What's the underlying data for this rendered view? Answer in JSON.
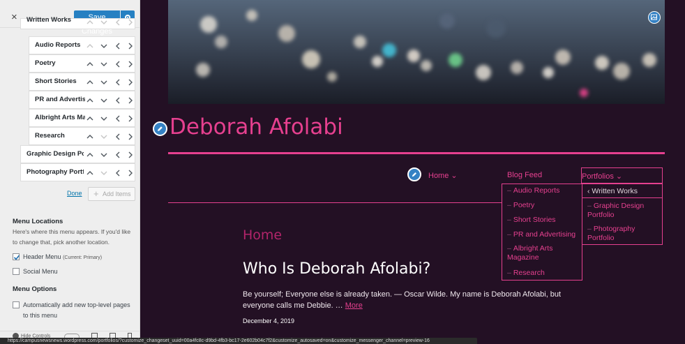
{
  "toolbar": {
    "close_label": "×",
    "save_label": "Save Changes"
  },
  "menu_items": [
    {
      "label": "Written Works",
      "level": 0,
      "arrows": [
        "up",
        "down",
        "left",
        "right"
      ],
      "dim": [
        true,
        true,
        true,
        true
      ]
    },
    {
      "label": "Audio Reports",
      "level": 1,
      "arrows": [
        "up",
        "down",
        "left",
        "right"
      ],
      "dim": [
        true,
        false,
        false,
        false
      ]
    },
    {
      "label": "Poetry",
      "level": 1,
      "arrows": [
        "up",
        "down",
        "left",
        "right"
      ],
      "dim": [
        false,
        false,
        false,
        false
      ]
    },
    {
      "label": "Short Stories",
      "level": 1,
      "arrows": [
        "up",
        "down",
        "left",
        "right"
      ],
      "dim": [
        false,
        false,
        false,
        false
      ]
    },
    {
      "label": "PR and Advertising",
      "level": 1,
      "arrows": [
        "up",
        "down",
        "left",
        "right"
      ],
      "dim": [
        false,
        false,
        false,
        false
      ]
    },
    {
      "label": "Albright Arts Magazine",
      "level": 1,
      "arrows": [
        "up",
        "down",
        "left",
        "right"
      ],
      "dim": [
        false,
        false,
        false,
        false
      ]
    },
    {
      "label": "Research",
      "level": 1,
      "arrows": [
        "up",
        "down",
        "left",
        "right"
      ],
      "dim": [
        false,
        true,
        false,
        false
      ]
    },
    {
      "label": "Graphic Design Portfolio",
      "level": 0,
      "arrows": [
        "up",
        "down",
        "left",
        "right"
      ],
      "dim": [
        false,
        false,
        false,
        false
      ]
    },
    {
      "label": "Photography Portfolio",
      "level": 0,
      "arrows": [
        "up",
        "down",
        "left",
        "right"
      ],
      "dim": [
        false,
        true,
        false,
        false
      ]
    }
  ],
  "menu_actions": {
    "done_label": "Done",
    "add_items_label": "Add Items"
  },
  "menu_locations": {
    "title": "Menu Locations",
    "description": "Here's where this menu appears. If you'd like to change that, pick another location.",
    "options": [
      {
        "label": "Header Menu",
        "note": "(Current: Primary)",
        "checked": true
      },
      {
        "label": "Social Menu",
        "note": "",
        "checked": false
      }
    ]
  },
  "menu_options": {
    "title": "Menu Options",
    "auto_add_label": "Automatically add new top-level pages to this menu",
    "auto_add_checked": false
  },
  "footer": {
    "hide_controls_label": "Hide Controls"
  },
  "preview": {
    "site_title": "Deborah Afolabi",
    "nav": {
      "home": "Home ⌄",
      "blog": "Blog Feed",
      "portfolios": "Portfolios ⌄"
    },
    "submenu_written": [
      "Audio Reports",
      "Poetry",
      "Short Stories",
      "PR and Advertising",
      "Albright Arts Magazine",
      "Research"
    ],
    "submenu_portfolios_head": "‹  Written Works",
    "submenu_portfolios": [
      "Graphic Design Portfolio",
      "Photography Portfolio"
    ],
    "page_heading": "Home",
    "post_title": "Who Is Deborah Afolabi?",
    "post_excerpt": "Be yourself; Everyone else is already taken. — Oscar Wilde. My name is Deborah Afolabi, but everyone calls me Debbie. …",
    "more_label": "More",
    "post_date": "December 4, 2019"
  },
  "status_url": "https://campusnewsnews.wordpress.com/portfolios/?customize_changeset_uuid=00a4fc8c-d9bd-4fb3-bc17-2e602b04c7f2&customize_autosaved=on&customize_messenger_channel=preview-16",
  "colors": {
    "accent": "#e6408f",
    "background": "#231024",
    "save_button": "#2680c2",
    "edit_button": "#3582c4"
  }
}
